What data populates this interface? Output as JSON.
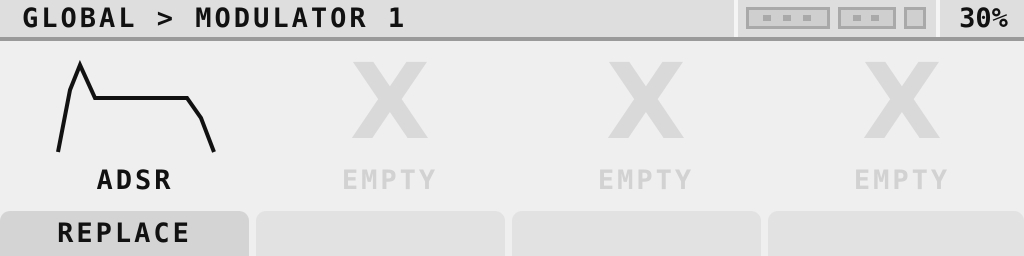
{
  "header": {
    "breadcrumb": "GLOBAL > MODULATOR 1",
    "battery_percent_label": "30%"
  },
  "slots": [
    {
      "label": "ADSR",
      "icon": "adsr-envelope-icon",
      "state": "active"
    },
    {
      "label": "EMPTY",
      "icon": "x-icon",
      "placeholder_glyph": "X",
      "state": "empty"
    },
    {
      "label": "EMPTY",
      "icon": "x-icon",
      "placeholder_glyph": "X",
      "state": "empty"
    },
    {
      "label": "EMPTY",
      "icon": "x-icon",
      "placeholder_glyph": "X",
      "state": "empty"
    }
  ],
  "softkeys": [
    {
      "label": "REPLACE"
    },
    {
      "label": ""
    },
    {
      "label": ""
    },
    {
      "label": ""
    }
  ],
  "colors": {
    "background": "#efefef",
    "header": "#dedede",
    "text": "#111111",
    "disabled_text": "#d2d2d2",
    "softkey": "#e2e2e2"
  }
}
